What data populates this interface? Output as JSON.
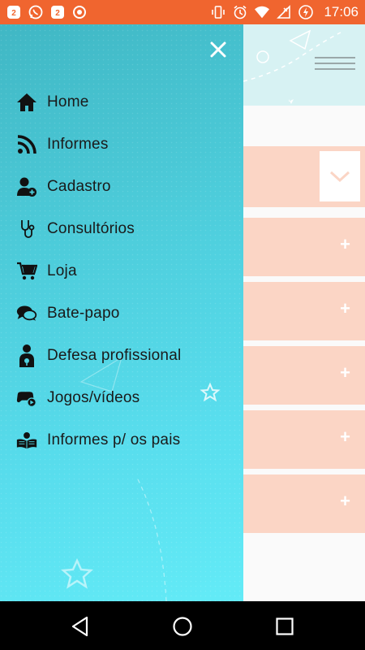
{
  "status_bar": {
    "time": "17:06",
    "notification_icons": [
      "notification-badge-icon",
      "whatsapp-icon",
      "notification-badge-icon",
      "record-icon"
    ],
    "system_icons": [
      "vibrate-icon",
      "alarm-icon",
      "wifi-icon",
      "signal-icon",
      "battery-charging-icon"
    ],
    "badge_number": "2",
    "color": "#f0652f"
  },
  "drawer": {
    "gradient_start": "#40b7c4",
    "gradient_end": "#63ebf7",
    "items": [
      {
        "label": "Home",
        "icon": "home-icon"
      },
      {
        "label": "Informes",
        "icon": "rss-icon"
      },
      {
        "label": "Cadastro",
        "icon": "add-user-icon"
      },
      {
        "label": "Consultórios",
        "icon": "stethoscope-icon"
      },
      {
        "label": "Loja",
        "icon": "cart-icon"
      },
      {
        "label": "Bate-papo",
        "icon": "chat-icon"
      },
      {
        "label": "Defesa profissional",
        "icon": "doctor-icon"
      },
      {
        "label": "Jogos/vídeos",
        "icon": "gamepad-video-icon"
      },
      {
        "label": "Informes p/ os pais",
        "icon": "parent-reading-icon"
      }
    ]
  },
  "page": {
    "accordion_color": "#fbd5c5",
    "expand_symbol": "+"
  },
  "nav_bar": {
    "buttons": [
      "back-icon",
      "home-circle-icon",
      "recents-icon"
    ]
  }
}
